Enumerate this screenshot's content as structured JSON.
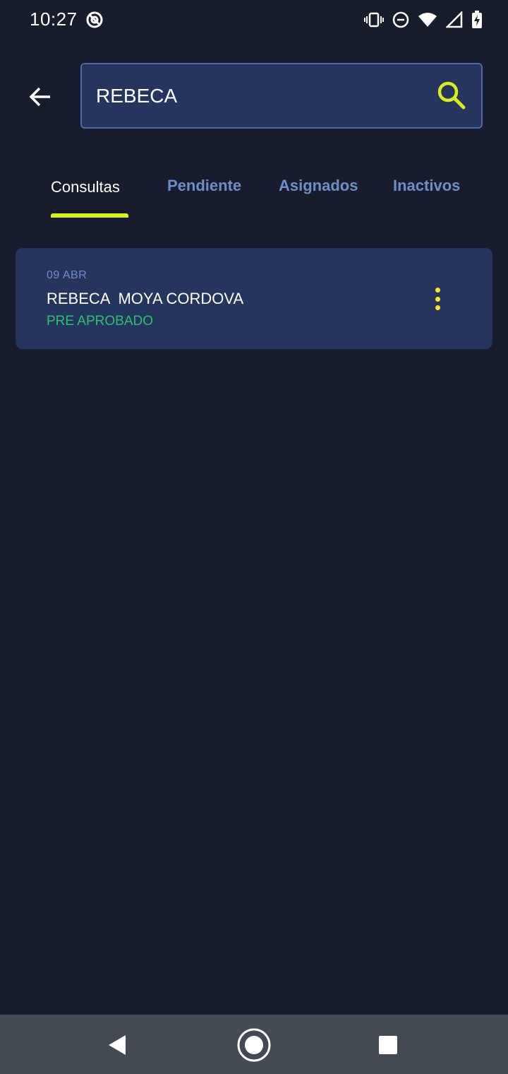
{
  "status_bar": {
    "time": "10:27",
    "app_icon": "at-sign-icon",
    "icons": [
      "vibrate-icon",
      "do-not-disturb-icon",
      "wifi-icon",
      "signal-icon",
      "battery-charging-icon"
    ]
  },
  "header": {
    "back_icon": "arrow-left-icon",
    "search": {
      "value": "REBECA",
      "icon": "search-icon"
    }
  },
  "tabs": [
    {
      "label": "Consultas",
      "active": true
    },
    {
      "label": "Pendiente",
      "active": false
    },
    {
      "label": "Asignados",
      "active": false
    },
    {
      "label": "Inactivos",
      "active": false
    }
  ],
  "results": [
    {
      "date": "09 ABR",
      "name": "REBECA  MOYA CORDOVA",
      "status": "PRE APROBADO",
      "more_icon": "more-vertical-icon"
    }
  ],
  "nav_bar": {
    "back": "nav-back-icon",
    "home": "nav-home-icon",
    "recents": "nav-recents-icon"
  },
  "colors": {
    "background": "#171d2c",
    "surface": "#25365e",
    "accent": "#d7f01a",
    "status_approved": "#2fbf6a",
    "tab_inactive": "#6c8fc8"
  }
}
